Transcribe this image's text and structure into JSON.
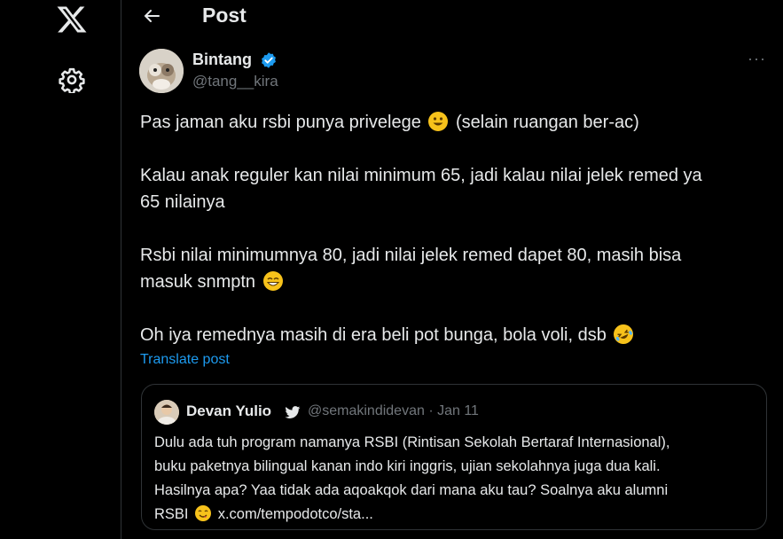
{
  "header": {
    "title": "Post"
  },
  "post": {
    "author_name": "Bintang",
    "author_handle": "@tang__kira",
    "lines": [
      "Pas jaman aku rsbi punya privelege",
      "(selain ruangan ber-ac)",
      "Kalau anak reguler kan nilai minimum 65, jadi kalau nilai jelek remed ya",
      "65 nilainya",
      "Rsbi nilai minimumnya 80, jadi nilai jelek remed dapet 80, masih bisa",
      "masuk snmptn",
      "Oh iya remednya masih di era beli pot bunga, bola voli, dsb"
    ],
    "translate_label": "Translate post",
    "more_label": "···"
  },
  "quote": {
    "author_name": "Devan Yulio",
    "meta": "@semakindidevan · Jan 11",
    "lines": [
      "Dulu ada tuh program namanya RSBI (Rintisan Sekolah Bertaraf Internasional),",
      "buku paketnya bilingual kanan indo kiri inggris, ujian sekolahnya juga dua kali.",
      "Hasilnya apa? Yaa tidak ada aqoakqok dari mana aku tau? Soalnya aku alumni",
      "RSBI",
      "x.com/tempodotco/sta..."
    ]
  },
  "icons": {
    "logo": "x-logo-icon",
    "settings": "gear-icon",
    "back": "back-arrow-icon",
    "verified": "verified-badge-icon",
    "legacy": "twitter-bird-icon"
  },
  "colors": {
    "background": "#000000",
    "text": "#e7e9ea",
    "secondary": "#71767b",
    "accent": "#1d9bf0",
    "border": "#2f3336"
  }
}
